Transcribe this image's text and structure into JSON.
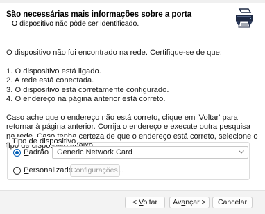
{
  "header": {
    "title": "São necessárias mais informações sobre a porta",
    "subtitle": "O dispositivo não pôde ser identificado.",
    "icon": "printer-icon"
  },
  "body": {
    "intro": "O dispositivo não foi encontrado na rede.  Certifique-se de que:",
    "checklist": [
      "1. O dispositivo está ligado.",
      "2. A rede está conectada.",
      "3. O dispositivo está corretamente configurado.",
      "4. O endereço na página anterior está correto."
    ],
    "help": "Caso ache que o endereço não está correto, clique em 'Voltar' para retornar à página anterior. Corrija o endereço e execute outra pesquisa na rede. Caso tenha certeza de que o endereço está correto, selecione o tipo de dispositivo abaixo."
  },
  "device_type": {
    "group_label": "Tipo de dispositivo",
    "standard_label_prefix": "",
    "standard_label_mnemonic": "P",
    "standard_label_rest": "adrão",
    "standard_selected": true,
    "standard_value": "Generic Network Card",
    "custom_label_mnemonic": "P",
    "custom_label_rest": "ersonalizado",
    "custom_selected": false,
    "settings_button": "Configurações..."
  },
  "footer": {
    "back_prefix": "< ",
    "back_mnemonic": "V",
    "back_rest": "oltar",
    "next_prefix": "Av",
    "next_mnemonic": "a",
    "next_rest": "nçar >",
    "cancel": "Cancelar"
  }
}
